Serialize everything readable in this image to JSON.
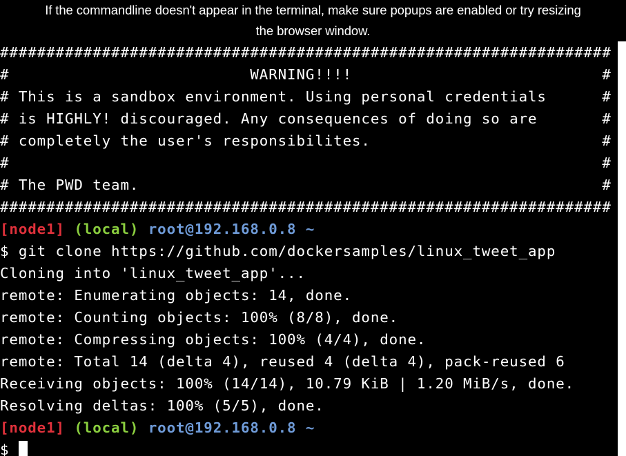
{
  "notice": {
    "line1": "If the commandline doesn't appear in the terminal, make sure popups are enabled or try resizing",
    "line2": "the browser window."
  },
  "colors": {
    "background": "#000000",
    "text": "#ffffff",
    "prompt_node": "#e0313b",
    "prompt_local": "#8bcf3f",
    "prompt_host": "#6f9bd8"
  },
  "terminal": {
    "banner": [
      "##################################################################",
      "#                          WARNING!!!!                           #",
      "# This is a sandbox environment. Using personal credentials      #",
      "# is HIGHLY! discouraged. Any consequences of doing so are       #",
      "# completely the user's responsibilites.                         #",
      "#                                                                #",
      "# The PWD team.                                                  #",
      "##################################################################"
    ],
    "prompt1": {
      "node": "[node1]",
      "local": "(local)",
      "host": "root@192.168.0.8",
      "dir": "~"
    },
    "command": "$ git clone https://github.com/dockersamples/linux_tweet_app",
    "output": [
      "Cloning into 'linux_tweet_app'...",
      "remote: Enumerating objects: 14, done.",
      "remote: Counting objects: 100% (8/8), done.",
      "remote: Compressing objects: 100% (4/4), done.",
      "remote: Total 14 (delta 4), reused 4 (delta 4), pack-reused 6",
      "Receiving objects: 100% (14/14), 10.79 KiB | 1.20 MiB/s, done.",
      "Resolving deltas: 100% (5/5), done."
    ],
    "prompt2": {
      "node": "[node1]",
      "local": "(local)",
      "host": "root@192.168.0.8",
      "dir": "~"
    },
    "input_prompt": "$"
  }
}
